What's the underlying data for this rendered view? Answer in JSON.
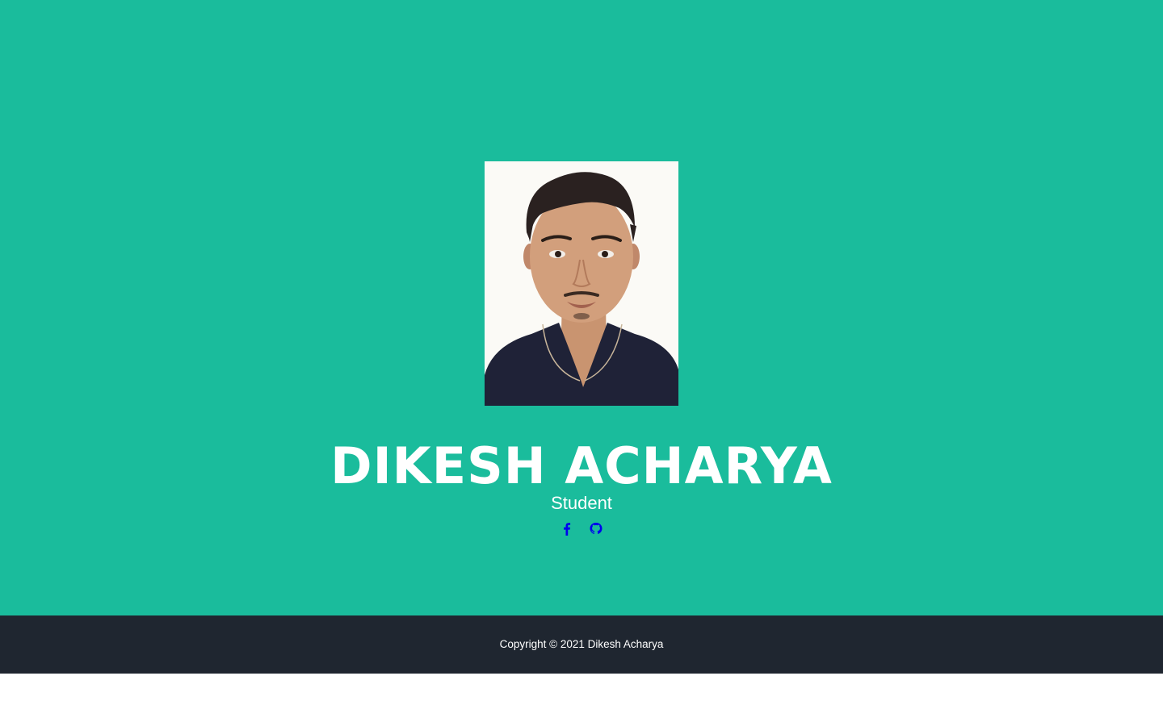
{
  "profile": {
    "name": "DIKESH ACHARYA",
    "role": "Student",
    "photo_alt": "Dikesh Acharya"
  },
  "social": [
    {
      "icon": "facebook-icon"
    },
    {
      "icon": "github-icon"
    }
  ],
  "footer": {
    "copyright": "Copyright © 2021 Dikesh Acharya"
  },
  "colors": {
    "hero_bg": "#1abc9c",
    "footer_bg": "#1f2630",
    "text": "#ffffff",
    "icon": "#0000ee"
  }
}
